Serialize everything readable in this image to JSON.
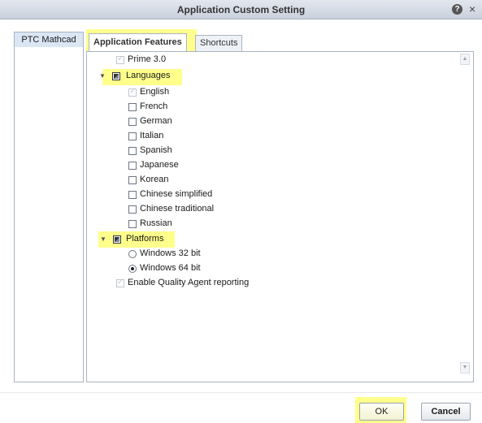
{
  "dialog": {
    "title": "Application Custom Setting",
    "help_icon": "question-icon",
    "help_glyph": "?",
    "close_icon": "close-icon",
    "close_glyph": "×"
  },
  "sidebar": {
    "items": [
      {
        "label": "PTC Mathcad",
        "selected": true
      }
    ]
  },
  "tabs": [
    {
      "label": "Application Features",
      "active": true
    },
    {
      "label": "Shortcuts",
      "active": false
    }
  ],
  "features": {
    "prime": {
      "label": "Prime 3.0",
      "checked": true,
      "disabled": true
    },
    "languages": {
      "label": "Languages",
      "expanded": true,
      "state": "partial",
      "items": [
        {
          "label": "English",
          "checked": true,
          "disabled": true
        },
        {
          "label": "French",
          "checked": false
        },
        {
          "label": "German",
          "checked": false
        },
        {
          "label": "Italian",
          "checked": false
        },
        {
          "label": "Spanish",
          "checked": false
        },
        {
          "label": "Japanese",
          "checked": false
        },
        {
          "label": "Korean",
          "checked": false
        },
        {
          "label": "Chinese simplified",
          "checked": false
        },
        {
          "label": "Chinese traditional",
          "checked": false
        },
        {
          "label": "Russian",
          "checked": false
        }
      ]
    },
    "platforms": {
      "label": "Platforms",
      "expanded": true,
      "state": "partial",
      "options": [
        {
          "label": "Windows 32 bit",
          "selected": false
        },
        {
          "label": "Windows 64 bit",
          "selected": true
        }
      ]
    },
    "quality_agent": {
      "label": "Enable Quality Agent reporting",
      "checked": true,
      "disabled": true
    }
  },
  "buttons": {
    "ok": "OK",
    "cancel": "Cancel"
  },
  "colors": {
    "highlight": "#ffff8c",
    "titlebar": "#c9d1dc",
    "border": "#a9b4c1"
  }
}
